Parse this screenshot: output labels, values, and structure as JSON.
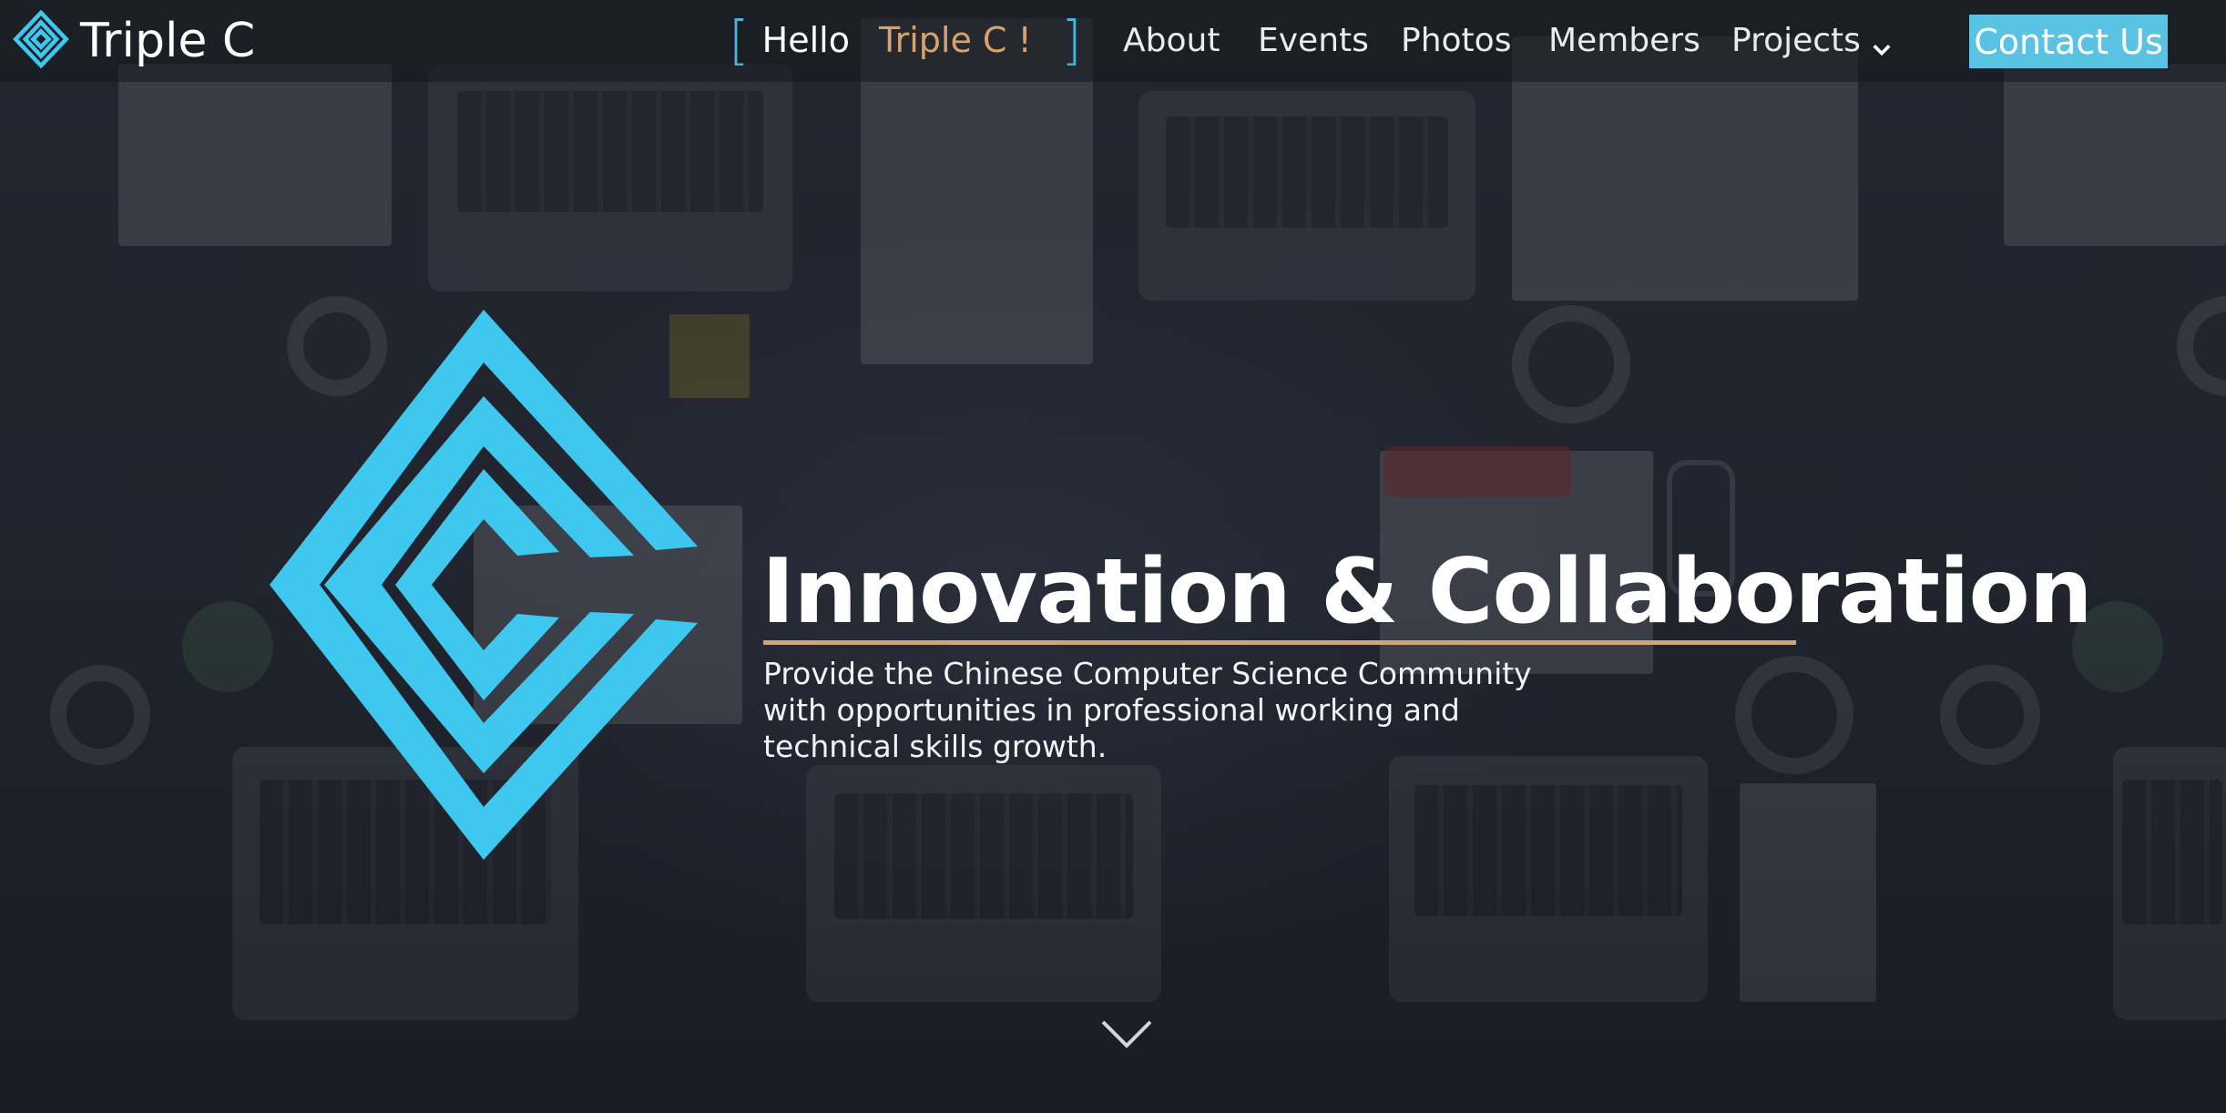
{
  "brand": {
    "name": "Triple C",
    "logo_icon": "triple-c-diamond-logo-icon",
    "accent_color": "#3ec7ef"
  },
  "header": {
    "greeting": {
      "hello": "Hello",
      "name": "Triple C !",
      "bracket_open": "[",
      "bracket_close": "]",
      "name_color": "#d6a36d",
      "bracket_color": "#46b6dc"
    },
    "nav": {
      "items": [
        {
          "label": "About"
        },
        {
          "label": "Events"
        },
        {
          "label": "Photos"
        },
        {
          "label": "Members"
        },
        {
          "label": "Projects",
          "icon": "chevron-down-icon"
        }
      ]
    },
    "contact_button": {
      "label": "Contact Us",
      "color": "#5ac2e3"
    }
  },
  "hero": {
    "title": "Innovation & Collaboration",
    "title_rule_color": "#d6a36d",
    "description_lines": [
      "Provide the Chinese Computer Science Community",
      "with opportunities in professional working and",
      "technical skills growth."
    ],
    "scroll_icon": "chevron-down-icon"
  }
}
